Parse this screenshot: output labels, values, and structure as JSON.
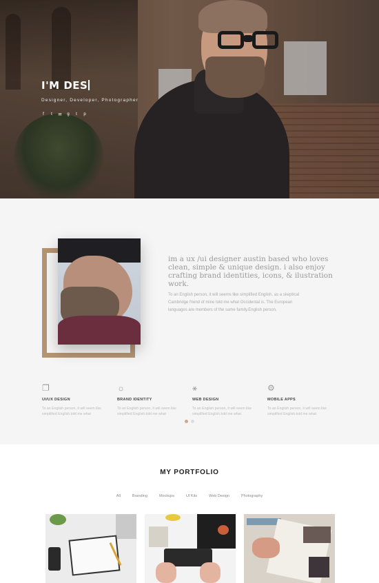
{
  "hero": {
    "title": "I'M DES",
    "subtitle": "Designer, Developer, Photographer",
    "socials": [
      {
        "icon": "facebook-icon",
        "glyph": "f"
      },
      {
        "icon": "twitter-icon",
        "glyph": "t"
      },
      {
        "icon": "email-icon",
        "glyph": "✉"
      },
      {
        "icon": "google-plus-icon",
        "glyph": "g"
      },
      {
        "icon": "tumblr-icon",
        "glyph": "t"
      },
      {
        "icon": "pinterest-icon",
        "glyph": "p"
      }
    ]
  },
  "about": {
    "heading": "im a ux /ui designer austin based who loves clean, simple & unique design. i also enjoy crafting brand identities, icons, & ilustration work.",
    "body": "To an English person, it will seems like simplified English, as a skeptical Cambridge friend of mine told me what Occidental is. The European languages are members of the same family.English person.",
    "accent_color": "#b59473"
  },
  "services": [
    {
      "icon": "layers-icon",
      "glyph": "❐",
      "title": "UI/UX DESIGN",
      "desc": "To an English person, it will seem like simplified English.told me what"
    },
    {
      "icon": "lightbulb-icon",
      "glyph": "☼",
      "title": "BRAND IDENTITY",
      "desc": "To an English person, it will seem like simplified English.told me what"
    },
    {
      "icon": "magic-wand-icon",
      "glyph": "⚹",
      "title": "WEB DESIGN",
      "desc": "To an English person, it will seem like simplified English.told me what"
    },
    {
      "icon": "android-icon",
      "glyph": "⚙",
      "title": "MOBILE APPS",
      "desc": "To an English person, it will seem like simplified English.told me what"
    }
  ],
  "pagination": {
    "total": 2,
    "active": 1
  },
  "portfolio": {
    "title": "MY PORTFOLIO",
    "filters": [
      "All",
      "Branding",
      "Mockups",
      "UI Kits",
      "Web Design",
      "Photography"
    ]
  }
}
